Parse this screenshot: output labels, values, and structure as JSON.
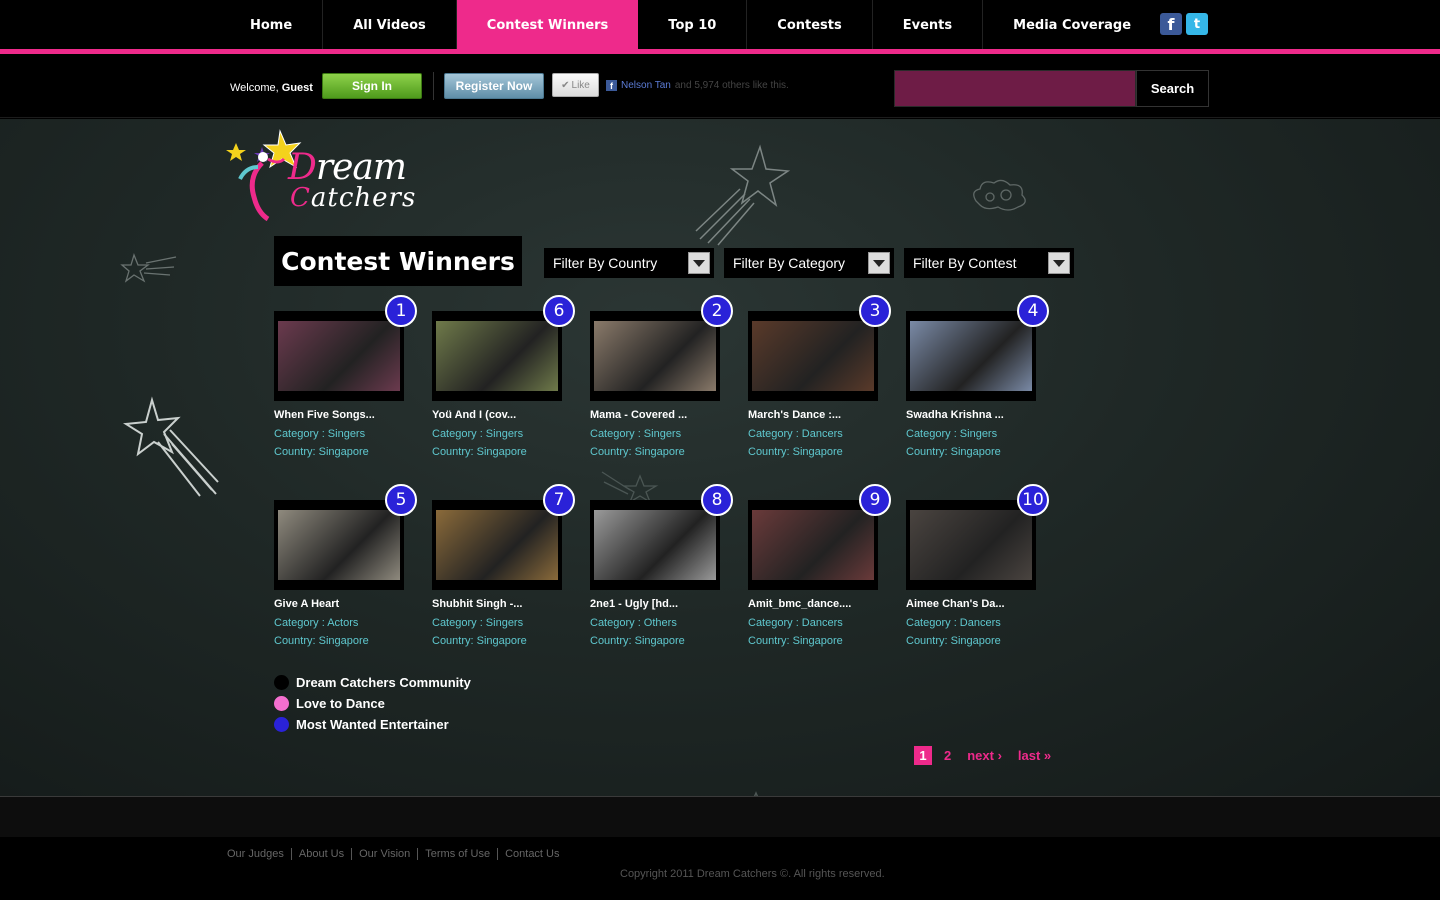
{
  "nav": {
    "items": [
      {
        "label": "Home"
      },
      {
        "label": "All Videos"
      },
      {
        "label": "Contest Winners",
        "active": true
      },
      {
        "label": "Top 10"
      },
      {
        "label": "Contests"
      },
      {
        "label": "Events"
      },
      {
        "label": "Media Coverage"
      }
    ],
    "social": [
      {
        "name": "facebook-icon",
        "glyph": "f"
      },
      {
        "name": "twitter-icon",
        "glyph": "t"
      }
    ]
  },
  "userbar": {
    "welcome_prefix": "Welcome,",
    "welcome_user": "Guest",
    "signin_label": "Sign In",
    "register_label": "Register Now",
    "like_label": "Like",
    "like_user": "Nelson Tan",
    "like_rest": "and 5,974 others like this.",
    "search_value": "",
    "search_label": "Search"
  },
  "logo": {
    "line1": "Dream",
    "line2": "Catchers"
  },
  "page_title": "Contest Winners",
  "filters": [
    "Filter By Country",
    "Filter By Category",
    "Filter By Contest"
  ],
  "videos": [
    {
      "rank": "1",
      "title": "When Five Songs...",
      "category": "Category : Singers",
      "country": "Country: Singapore",
      "thumb": "#6b3a4e"
    },
    {
      "rank": "6",
      "title": "Yoü And I (cov...",
      "category": "Category : Singers",
      "country": "Country: Singapore",
      "thumb": "#6f7a4a"
    },
    {
      "rank": "2",
      "title": "Mama - Covered ...",
      "category": "Category : Singers",
      "country": "Country: Singapore",
      "thumb": "#8a7a6a"
    },
    {
      "rank": "3",
      "title": "March's Dance :...",
      "category": "Category : Dancers",
      "country": "Country: Singapore",
      "thumb": "#5a3a2a"
    },
    {
      "rank": "4",
      "title": "Swadha Krishna ...",
      "category": "Category : Singers",
      "country": "Country: Singapore",
      "thumb": "#7a8aa6"
    },
    {
      "rank": "5",
      "title": "Give A Heart",
      "category": "Category : Actors",
      "country": "Country: Singapore",
      "thumb": "#8f8a7e"
    },
    {
      "rank": "7",
      "title": "Shubhit Singh -...",
      "category": "Category : Singers",
      "country": "Country: Singapore",
      "thumb": "#8a6a3a"
    },
    {
      "rank": "8",
      "title": "2ne1 - Ugly [hd...",
      "category": "Category : Others",
      "country": "Country: Singapore",
      "thumb": "#9a9a9a"
    },
    {
      "rank": "9",
      "title": "Amit_bmc_dance....",
      "category": "Category : Dancers",
      "country": "Country: Singapore",
      "thumb": "#6a3a3a"
    },
    {
      "rank": "10",
      "title": "Aimee Chan's Da...",
      "category": "Category : Dancers",
      "country": "Country: Singapore",
      "thumb": "#4a4440"
    }
  ],
  "legend": [
    {
      "label": "Dream Catchers Community",
      "color": "#000000"
    },
    {
      "label": "Love to Dance",
      "color": "#f46fcf"
    },
    {
      "label": "Most Wanted Entertainer",
      "color": "#2a22d8"
    }
  ],
  "pager": {
    "current": "1",
    "page2": "2",
    "next": "next ›",
    "last": "last »"
  },
  "footer": {
    "links": [
      "Our Judges",
      "About Us",
      "Our Vision",
      "Terms of Use",
      "Contact Us"
    ],
    "copyright": "Copyright 2011 Dream Catchers ©. All rights reserved."
  },
  "colors": {
    "accent": "#ee2a8b",
    "rank_badge": "#2a22d8",
    "meta_text": "#5fc8cf"
  }
}
